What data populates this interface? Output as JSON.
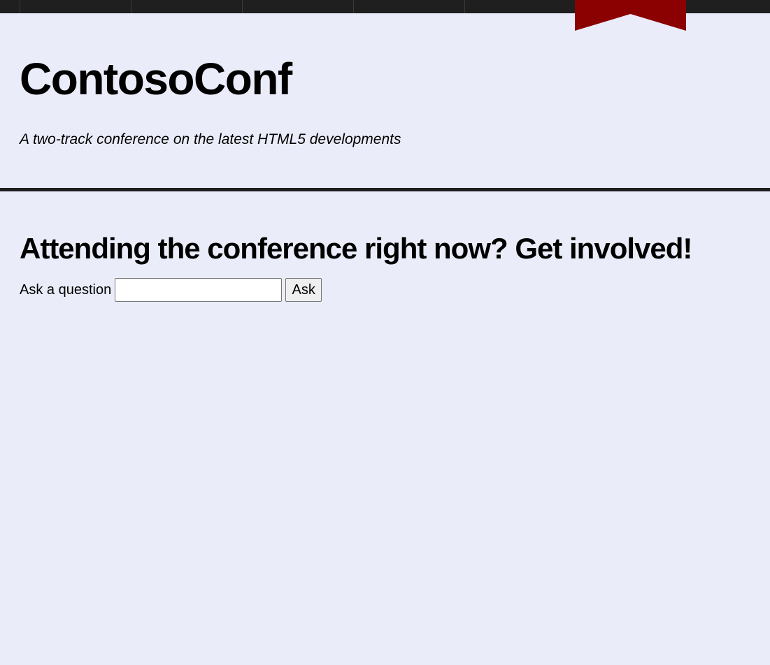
{
  "site": {
    "title": "ContosoConf",
    "tagline": "A two-track conference on the latest HTML5 developments"
  },
  "colors": {
    "background": "#eaedf9",
    "topbar": "#1f1f1f",
    "ribbon": "#8b0000"
  },
  "main": {
    "heading": "Attending the conference right now? Get involved!",
    "ask_label": "Ask a question",
    "ask_input_value": "",
    "ask_button_label": "Ask"
  }
}
